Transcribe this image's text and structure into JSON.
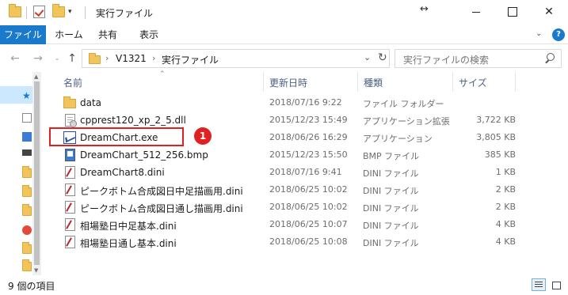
{
  "window": {
    "title": "実行ファイル",
    "controls": {
      "minimize": "",
      "maximize": "",
      "close": "✕"
    }
  },
  "ribbon": {
    "tabs": [
      "ファイル",
      "ホーム",
      "共有",
      "表示"
    ],
    "help": "?"
  },
  "address_bar": {
    "breadcrumbs": [
      "V1321",
      "実行ファイル"
    ],
    "separator": "›"
  },
  "search": {
    "placeholder": "実行ファイルの検索"
  },
  "columns": {
    "name": "名前",
    "modified": "更新日時",
    "type": "種類",
    "size": "サイズ"
  },
  "files": [
    {
      "name": "data",
      "modified": "2018/07/16 9:22",
      "type": "ファイル フォルダー",
      "size": "",
      "icon": "folder-icon"
    },
    {
      "name": "cpprest120_xp_2_5.dll",
      "modified": "2015/12/23 15:49",
      "type": "アプリケーション拡張",
      "size": "3,722 KB",
      "icon": "dll-file-icon"
    },
    {
      "name": "DreamChart.exe",
      "modified": "2018/06/26 16:29",
      "type": "アプリケーション",
      "size": "3,805 KB",
      "icon": "dreamchart-app-icon"
    },
    {
      "name": "DreamChart_512_256.bmp",
      "modified": "2015/12/23 15:50",
      "type": "BMP ファイル",
      "size": "385 KB",
      "icon": "bmp-file-icon"
    },
    {
      "name": "DreamChart8.dini",
      "modified": "2018/07/16 9:41",
      "type": "DINI ファイル",
      "size": "1 KB",
      "icon": "dini-file-icon"
    },
    {
      "name": "ピークボトム合成図日中足描画用.dini",
      "modified": "2018/06/25 10:02",
      "type": "DINI ファイル",
      "size": "2 KB",
      "icon": "dini-file-icon"
    },
    {
      "name": "ピークボトム合成図日通し描画用.dini",
      "modified": "2018/06/25 10:02",
      "type": "DINI ファイル",
      "size": "2 KB",
      "icon": "dini-file-icon"
    },
    {
      "name": "相場塾日中足基本.dini",
      "modified": "2018/06/25 10:07",
      "type": "DINI ファイル",
      "size": "4 KB",
      "icon": "dini-file-icon"
    },
    {
      "name": "相場塾日通し基本.dini",
      "modified": "2018/06/25 10:08",
      "type": "DINI ファイル",
      "size": "4 KB",
      "icon": "dini-file-icon"
    }
  ],
  "annotation": {
    "badge": "1",
    "color": "#e12121"
  },
  "status_bar": {
    "item_count": "9 個の項目"
  },
  "colors": {
    "accent": "#1979ca",
    "folder": "#f2c55c",
    "selection": "#cce8ff"
  }
}
